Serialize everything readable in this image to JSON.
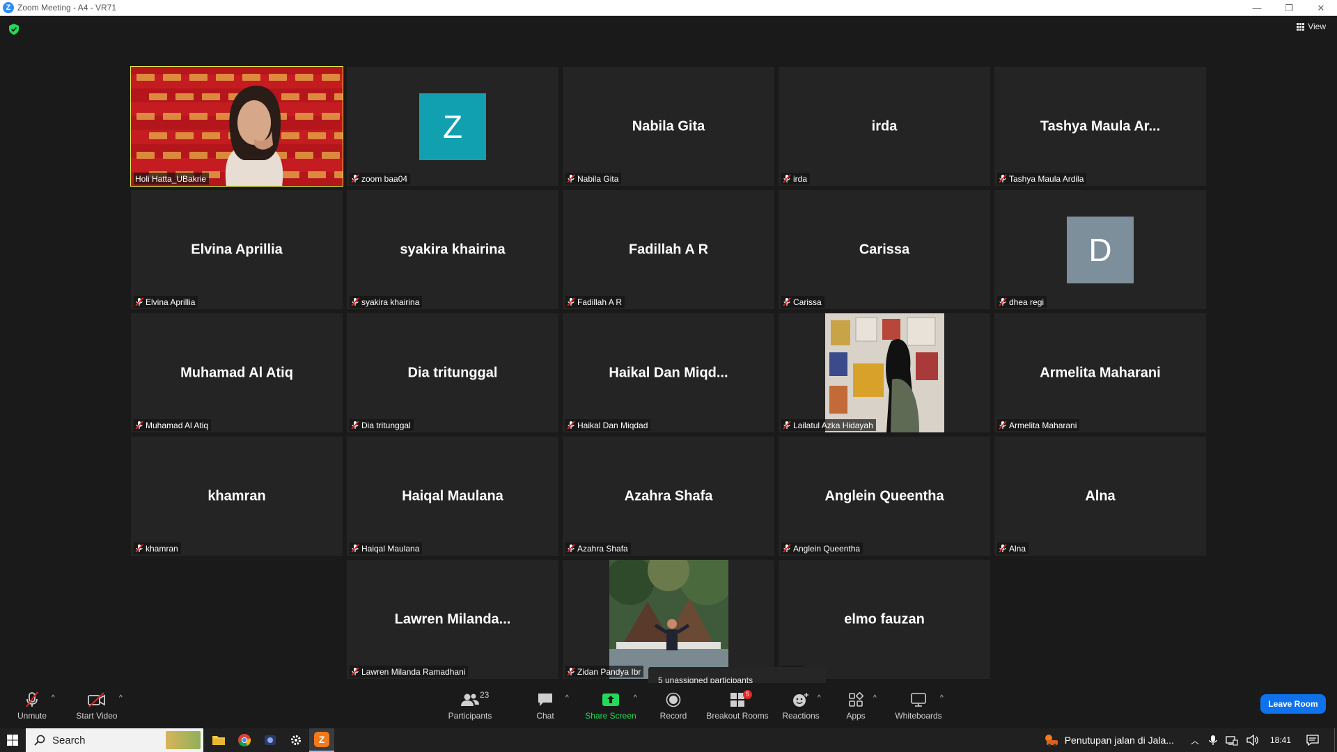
{
  "window": {
    "title": "Zoom Meeting - A4 - VR71",
    "minimize": "—",
    "restore": "❐",
    "close": "✕"
  },
  "top_bar": {
    "view_label": "View"
  },
  "participants_grid": [
    {
      "name": "Holi Hatta_UBakrie",
      "label": "Holi Hatta_UBakrie",
      "type": "video-bakrie",
      "active": true,
      "muted": false
    },
    {
      "name": "zoom baa04",
      "label": "zoom baa04",
      "type": "avatar",
      "avatar_letter": "Z",
      "avatar_color": "#11a0b0",
      "muted": true
    },
    {
      "name": "Nabila Gita",
      "label": "Nabila Gita",
      "type": "name",
      "muted": true
    },
    {
      "name": "irda",
      "label": "irda",
      "type": "name",
      "muted": true
    },
    {
      "name": "Tashya Maula Ar...",
      "label": "Tashya Maula Ardila",
      "type": "name",
      "muted": true
    },
    {
      "name": "Elvina Aprillia",
      "label": "Elvina Aprillia",
      "type": "name",
      "muted": true
    },
    {
      "name": "syakira khairina",
      "label": "syakira khairina",
      "type": "name",
      "muted": true
    },
    {
      "name": "Fadillah A R",
      "label": "Fadillah A R",
      "type": "name",
      "muted": true
    },
    {
      "name": "Carissa",
      "label": "Carissa",
      "type": "name",
      "muted": true
    },
    {
      "name": "dhea regi",
      "label": "dhea regi",
      "type": "avatar",
      "avatar_letter": "D",
      "avatar_color": "#7e8f9c",
      "muted": true
    },
    {
      "name": "Muhamad Al Atiq",
      "label": "Muhamad Al Atiq",
      "type": "name",
      "muted": true
    },
    {
      "name": "Dia tritunggal",
      "label": "Dia tritunggal",
      "type": "name",
      "muted": true
    },
    {
      "name": "Haikal Dan Miqd...",
      "label": "Haikal Dan Miqdad",
      "type": "name",
      "muted": true
    },
    {
      "name": "Lailatul Azka Hidayah",
      "label": "Lailatul Azka Hidayah",
      "type": "image-gallery",
      "muted": true
    },
    {
      "name": "Armelita Maharani",
      "label": "Armelita Maharani",
      "type": "name",
      "muted": true
    },
    {
      "name": "khamran",
      "label": "khamran",
      "type": "name",
      "muted": true
    },
    {
      "name": "Haiqal Maulana",
      "label": "Haiqal Maulana",
      "type": "name",
      "muted": true
    },
    {
      "name": "Azahra Shafa",
      "label": "Azahra Shafa",
      "type": "name",
      "muted": true
    },
    {
      "name": "Anglein Queentha",
      "label": "Anglein Queentha",
      "type": "name",
      "muted": true
    },
    {
      "name": "Alna",
      "label": "Alna",
      "type": "name",
      "muted": true
    },
    {
      "name": "Lawren Milanda...",
      "label": "Lawren Milanda Ramadhani",
      "type": "name",
      "muted": true
    },
    {
      "name": "Zidan Pandya Ibr",
      "label": "Zidan Pandya Ibr",
      "type": "image-forest",
      "muted": true
    },
    {
      "name": "elmo fauzan",
      "label": "uzan",
      "type": "name",
      "muted": false
    }
  ],
  "tooltip": {
    "text": "5 unassigned participants"
  },
  "toolbar": {
    "unmute": "Unmute",
    "start_video": "Start Video",
    "participants": "Participants",
    "participants_count": "23",
    "chat": "Chat",
    "share_screen": "Share Screen",
    "record": "Record",
    "breakout_rooms": "Breakout Rooms",
    "breakout_badge": "5",
    "reactions": "Reactions",
    "apps": "Apps",
    "whiteboards": "Whiteboards",
    "leave_room": "Leave Room",
    "caret": "^"
  },
  "taskbar": {
    "search_label": "Search",
    "news": "Penutupan jalan di Jala...",
    "time": "18:41"
  },
  "colors": {
    "accent": "#0e72ed",
    "active_speaker": "#e8e84a",
    "share": "#23d959",
    "muted": "#e02828"
  }
}
